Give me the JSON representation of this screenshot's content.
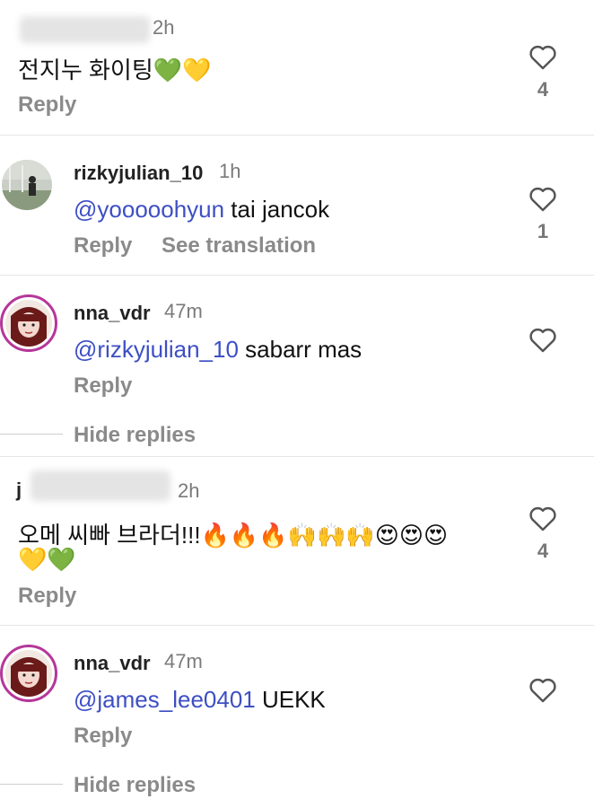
{
  "colors": {
    "mention": "#3d4fc4",
    "action": "#8a8a8a",
    "ring": "#b5379a"
  },
  "comments": [
    {
      "time": "2h",
      "text": "전지누 화이팅💚💛",
      "reply": "Reply",
      "likes": "4"
    },
    {
      "username": "rizkyjulian_10",
      "time": "1h",
      "mention": "@yooooohyun",
      "text": " tai jancok",
      "reply": "Reply",
      "translate": "See translation",
      "likes": "1"
    },
    {
      "username": "nna_vdr",
      "time": "47m",
      "mention": "@rizkyjulian_10",
      "text": " sabarr mas",
      "reply": "Reply",
      "hide": "Hide replies"
    },
    {
      "username_partial": "j",
      "time": "2h",
      "line1": "오메 씨빠 브라더!!!🔥🔥🔥🙌🙌🙌😍😍😍",
      "line2": "💛💚",
      "reply": "Reply",
      "likes": "4"
    },
    {
      "username": "nna_vdr",
      "time": "47m",
      "mention": "@james_lee0401",
      "text": " UEKK",
      "reply": "Reply",
      "hide": "Hide replies"
    }
  ],
  "icons": {
    "like": "heart-outline-icon",
    "mention_prefix": "at-icon"
  }
}
